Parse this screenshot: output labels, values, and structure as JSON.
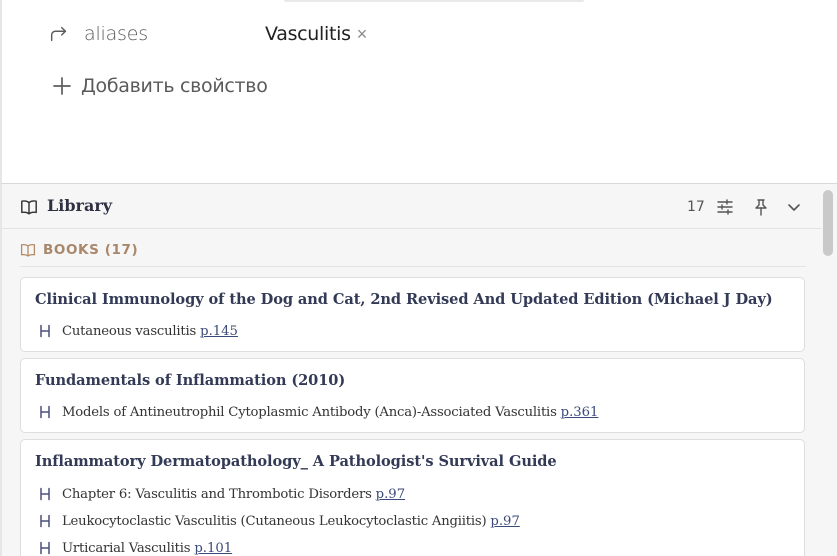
{
  "properties": {
    "aliases": {
      "key": "aliases",
      "icon": "arrow-turn-right-icon",
      "tags": [
        "Vasculitis"
      ],
      "remove_symbol": "×"
    },
    "add_label": "Добавить свойство",
    "add_icon": "plus-icon"
  },
  "library": {
    "title": "Library",
    "title_icon": "book-open-icon",
    "count": "17",
    "header_icons": [
      "sliders-icon",
      "pin-icon",
      "chevron-down-icon"
    ],
    "section": {
      "label": "BOOKS (17)",
      "icon": "book-open-icon"
    },
    "books": [
      {
        "title": "Clinical Immunology of the Dog and Cat, 2nd Revised And Updated Edition (Michael J Day)",
        "entries": [
          {
            "text": "Cutaneous vasculitis",
            "page": "p.145"
          }
        ]
      },
      {
        "title": "Fundamentals of Inflammation (2010)",
        "entries": [
          {
            "text": "Models of Antineutrophil Cytoplasmic Antibody (Anca)-Associated Vasculitis",
            "page": "p.361"
          }
        ]
      },
      {
        "title": "Inflammatory Dermatopathology_ A Pathologist's Survival Guide",
        "entries": [
          {
            "text": "Chapter 6: Vasculitis and Thrombotic Disorders",
            "page": "p.97"
          },
          {
            "text": "Leukocytoclastic Vasculitis (Cutaneous Leukocytoclastic Angiitis)",
            "page": "p.97"
          },
          {
            "text": "Urticarial Vasculitis",
            "page": "p.101"
          }
        ]
      }
    ],
    "accent_color": "#a8876a",
    "link_color": "#3a4a7a"
  }
}
